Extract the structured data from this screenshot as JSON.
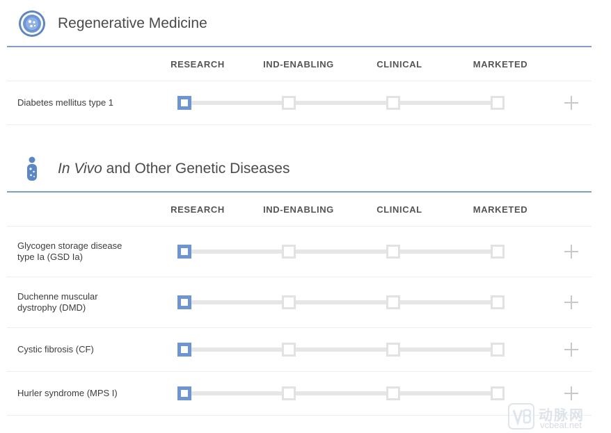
{
  "stage_headers": [
    "RESEARCH",
    "IND-ENABLING",
    "CLINICAL",
    "MARKETED"
  ],
  "sections": [
    {
      "title_pre": "",
      "title_em": "",
      "title_post": "Regenerative Medicine",
      "icon": "cell-icon",
      "rows": [
        {
          "label": "Diabetes mellitus type 1",
          "stage": 1
        }
      ]
    },
    {
      "title_pre": "",
      "title_em": "In Vivo",
      "title_post": " and Other Genetic Diseases",
      "icon": "person-icon",
      "rows": [
        {
          "label": "Glycogen storage disease type Ia (GSD Ia)",
          "stage": 1
        },
        {
          "label": "Duchenne muscular dystrophy (DMD)",
          "stage": 1
        },
        {
          "label": "Cystic fibrosis (CF)",
          "stage": 1
        },
        {
          "label": "Hurler syndrome (MPS I)",
          "stage": 1
        }
      ]
    }
  ],
  "watermark": {
    "cn": "动脉网",
    "en": "vcbeat.net",
    "logo_icon": "vb-logo-icon"
  },
  "colors": {
    "accent": "#6b95d8",
    "divider": "#7a9fd3",
    "track": "#e6e6e6",
    "inactive_node": "#e2e2e2",
    "plus": "#c8c8c8"
  }
}
